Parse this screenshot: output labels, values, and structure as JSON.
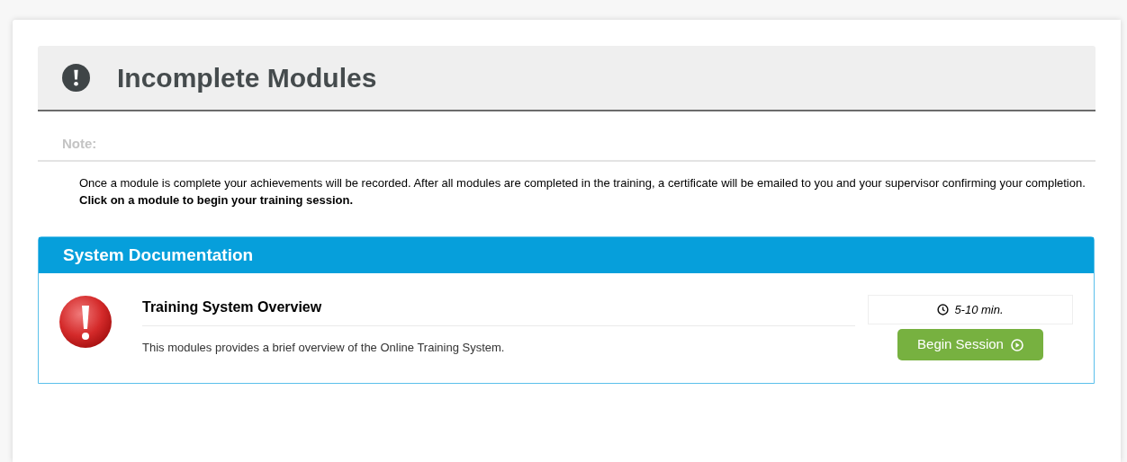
{
  "header": {
    "title": "Incomplete Modules"
  },
  "note": {
    "label": "Note:",
    "text": "Once a module is complete your achievements will be recorded. After all modules are completed in the training, a certificate will be emailed to you and your supervisor confirming your completion.",
    "instruction": "Click on a module to begin your training session."
  },
  "sections": [
    {
      "title": "System Documentation",
      "modules": [
        {
          "title": "Training System Overview",
          "description": "This modules provides a brief overview of the Online Training System.",
          "duration": "5-10 min.",
          "button": "Begin Session"
        }
      ]
    }
  ]
}
